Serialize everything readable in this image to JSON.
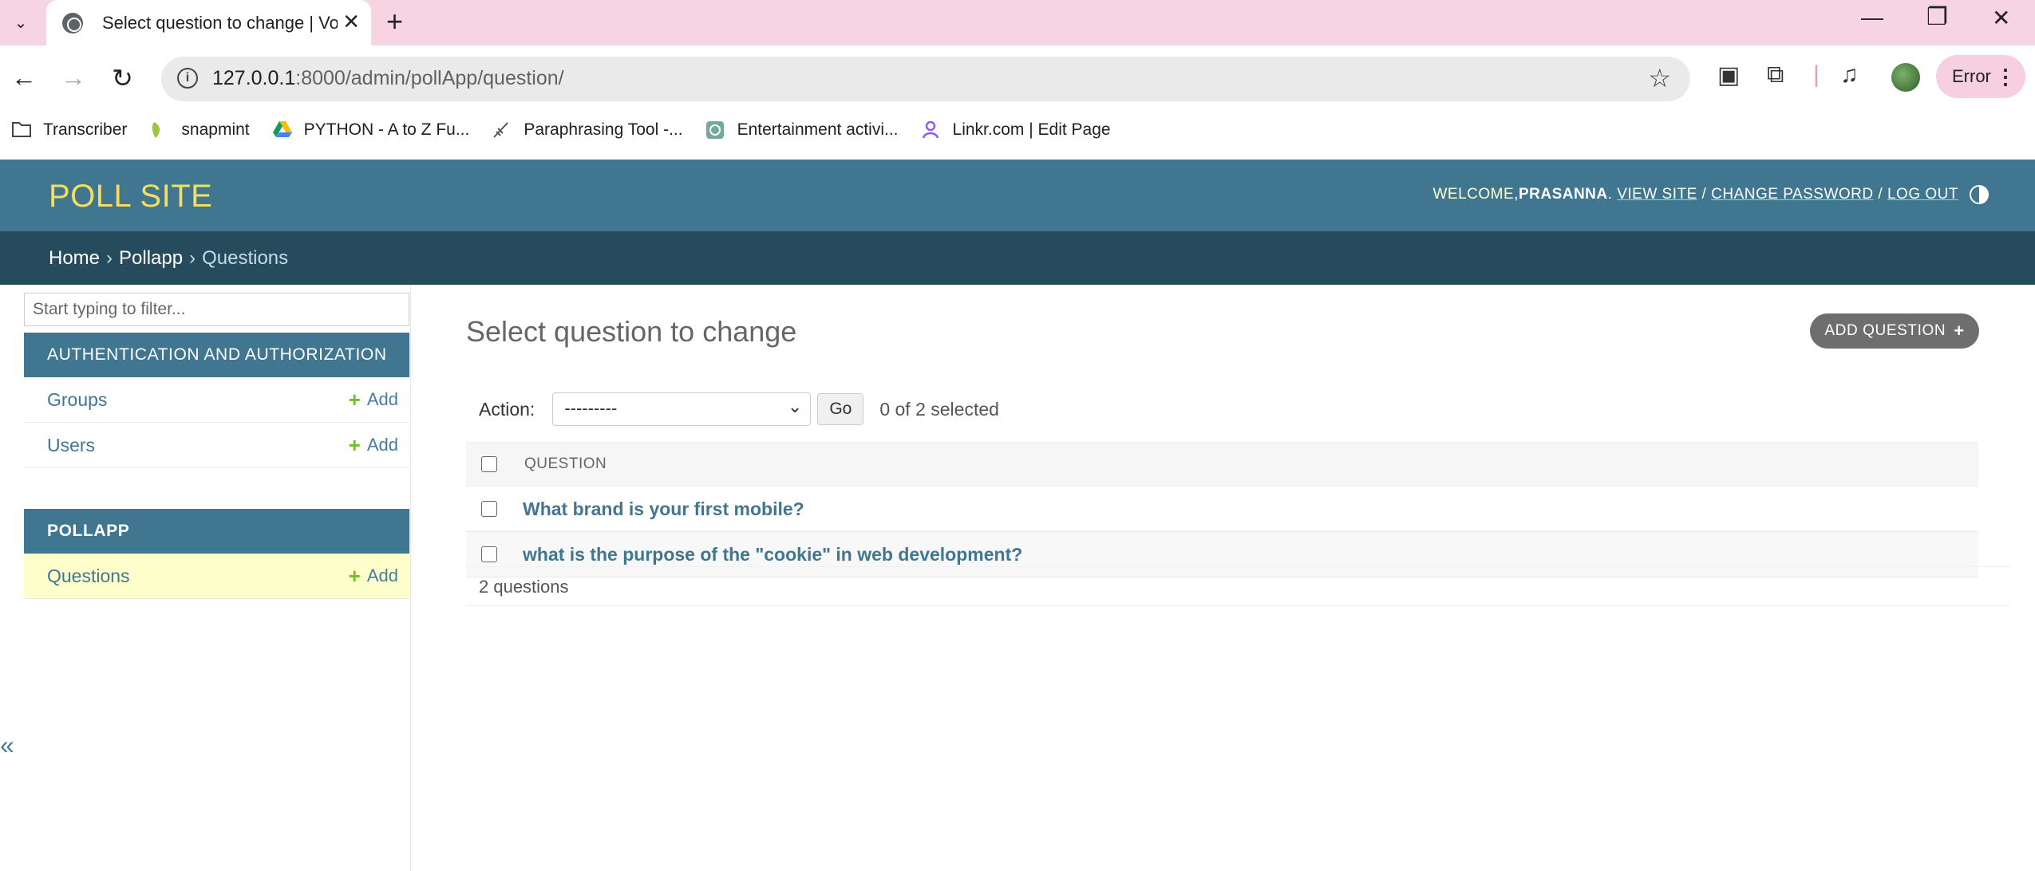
{
  "browser": {
    "tab_title": "Select question to change | Vot",
    "url_host": "127.0.0.1",
    "url_rest": ":8000/admin/pollApp/question/",
    "profile_status": "Error",
    "bookmarks": [
      {
        "label": "Transcriber",
        "icon": "folder-icon"
      },
      {
        "label": "snapmint",
        "icon": "snapmint-icon"
      },
      {
        "label": "PYTHON - A to Z Fu...",
        "icon": "drive-icon"
      },
      {
        "label": "Paraphrasing Tool -...",
        "icon": "quill-icon"
      },
      {
        "label": "Entertainment activi...",
        "icon": "chatgpt-icon"
      },
      {
        "label": "Linkr.com | Edit Page",
        "icon": "linkr-icon"
      }
    ]
  },
  "admin": {
    "site_name": "POLL SITE",
    "welcome": "WELCOME, ",
    "username": "PRASANNA",
    "view_site": "VIEW SITE",
    "change_password": "CHANGE PASSWORD",
    "log_out": "LOG OUT",
    "breadcrumbs": {
      "home": "Home",
      "app": "Pollapp",
      "current": "Questions"
    }
  },
  "sidebar": {
    "filter_placeholder": "Start typing to filter...",
    "modules": [
      {
        "caption": "AUTHENTICATION AND AUTHORIZATION",
        "rows": [
          {
            "label": "Groups",
            "add": "Add"
          },
          {
            "label": "Users",
            "add": "Add"
          }
        ]
      },
      {
        "caption": "POLLAPP",
        "rows": [
          {
            "label": "Questions",
            "add": "Add"
          }
        ]
      }
    ],
    "collapse": "«"
  },
  "content": {
    "title": "Select question to change",
    "add_button": "ADD QUESTION",
    "action_label": "Action:",
    "action_value": "---------",
    "go": "Go",
    "selection_counter": "0 of 2 selected",
    "column": "QUESTION",
    "rows": [
      "What brand is your first mobile?",
      "what is the purpose of the \"cookie\" in web development?"
    ],
    "result_count": "2 questions"
  }
}
